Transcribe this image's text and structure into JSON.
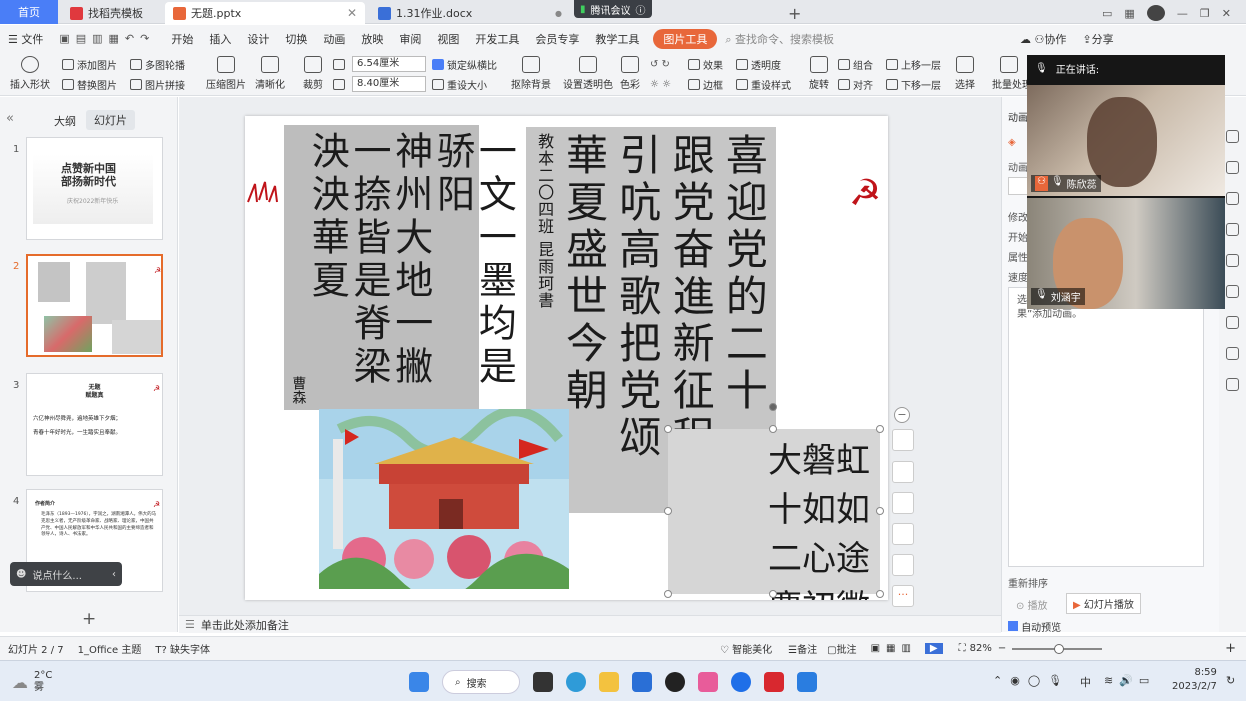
{
  "tabs": {
    "home": "首页",
    "template": "找稻壳模板",
    "pptx": "无题.pptx",
    "docx": "1.31作业.docx",
    "meeting": "腾讯会议"
  },
  "menu": {
    "file": "文件",
    "items": [
      "开始",
      "插入",
      "设计",
      "切换",
      "动画",
      "放映",
      "审阅",
      "视图",
      "开发工具",
      "会员专享",
      "教学工具"
    ],
    "picture_tools": "图片工具",
    "search": "查找命令、搜索模板",
    "collab": "协作",
    "share": "分享"
  },
  "ribbon": {
    "insert_shape": "插入形状",
    "add_picture": "添加图片",
    "multi_carousel": "多图轮播",
    "replace_picture": "替换图片",
    "picture_collage": "图片拼接",
    "compress": "压缩图片",
    "sharpen": "清晰化",
    "crop": "裁剪",
    "height": "6.54厘米",
    "width": "8.40厘米",
    "lock_ratio": "锁定纵横比",
    "reset_size": "重设大小",
    "remove_bg": "抠除背景",
    "set_transparent": "设置透明色",
    "color": "色彩",
    "effects": "效果",
    "transparency": "透明度",
    "border": "边框",
    "reset_style": "重设样式",
    "rotate": "旋转",
    "group": "组合",
    "align": "对齐",
    "bring_forward": "上移一层",
    "send_backward": "下移一层",
    "select": "选择",
    "batch": "批量处理"
  },
  "left_panel": {
    "outline": "大纲",
    "slides": "幻灯片",
    "nums": [
      "1",
      "2",
      "3",
      "4"
    ],
    "s1": {
      "line1": "点赞新中国",
      "line2": "部扬新时代",
      "small": "庆祝2022新年快乐"
    },
    "s3": {
      "title": "无题",
      "subtitle": "赋题真",
      "line1": "六亿神州尽舜尧，遍地英雄下夕烟；",
      "line2": "青春十年好时光，一生踏实且奉献。"
    },
    "s4": {
      "title": "作者简介",
      "body": "毛泽东（1893—1976），字润之，湖南湘潭人。伟大的马克思主义者，无产阶级革命家、战略家、理论家，中国共产党、中国人民解放军和中华人民共和国的主要缔造者和领导人，诗人、书法家。"
    },
    "chat_hint": "说点什么..."
  },
  "slide": {
    "work1": {
      "cols": [
        "一文一墨均是骄阳",
        "神州大地一撇一捺皆是脊梁",
        "泱泱華夏"
      ],
      "sig": "曹森"
    },
    "work2": {
      "cols": [
        "喜迎党的二十",
        "跟党奋進新征程",
        "引吭高歌把党颂",
        "華夏盛世今朝"
      ],
      "inscription": "教本二〇四班 昆雨珂書"
    },
    "work3": {
      "cols": [
        "大磐虹",
        "十如如",
        "二心途",
        "慶初徽"
      ]
    }
  },
  "notes": {
    "placeholder": "单击此处添加备注"
  },
  "right_panel": {
    "title": "动画窗格",
    "anim": "动画",
    "modify": "修改",
    "start": "开始",
    "property": "属性",
    "speed": "速度",
    "hint": "选中幻灯片中的对象，单击“添加效果”添加动画。",
    "reorder": "重新排序",
    "play": "播放",
    "slideshow": "幻灯片播放",
    "autopreview": "自动预览"
  },
  "meeting": {
    "speaking_label": "正在讲话:",
    "participant1": "陈欣蕊",
    "participant2": "刘涵宇"
  },
  "status": {
    "slide_index": "幻灯片 2 / 7",
    "theme": "1_Office 主题",
    "missing_font": "缺失字体",
    "smart_beautify": "智能美化",
    "notes": "备注",
    "comment": "批注",
    "zoom": "82%"
  },
  "taskbar": {
    "temp": "2°C",
    "weather": "雾",
    "search": "搜索",
    "lang": "中",
    "time": "8:59",
    "date": "2023/2/7"
  }
}
